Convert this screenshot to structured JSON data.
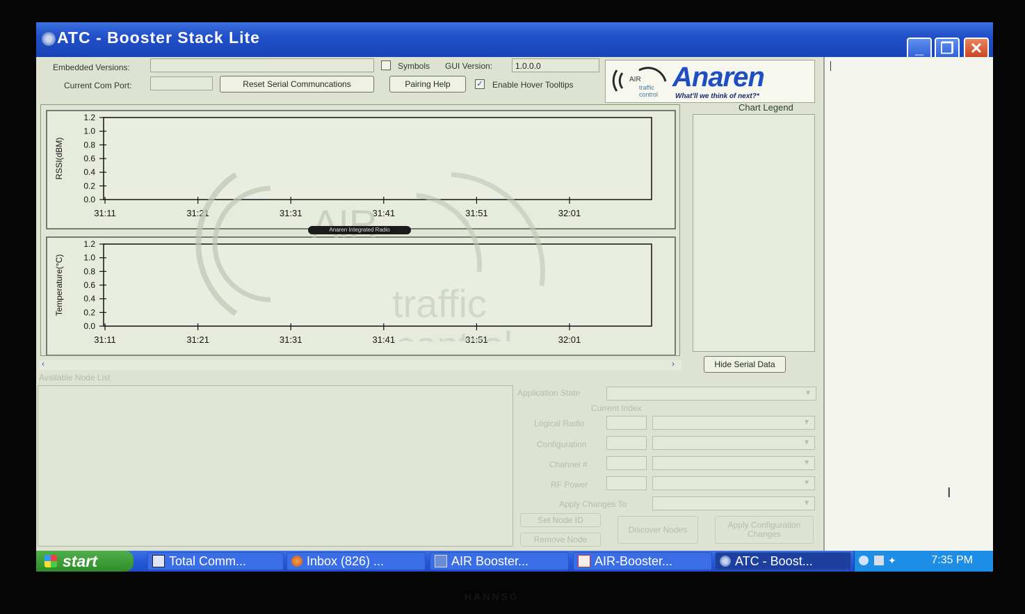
{
  "window": {
    "title": "ATC - Booster Stack Lite",
    "minimize_label": "_",
    "maximize_label": "❐",
    "close_label": "✕"
  },
  "toolbar": {
    "embedded_versions_label": "Embedded Versions:",
    "embedded_versions_value": "",
    "current_com_port_label": "Current Com Port:",
    "current_com_port_value": "",
    "reset_serial_label": "Reset Serial Communcations",
    "symbols_label": "Symbols",
    "symbols_checked": false,
    "gui_version_label": "GUI Version:",
    "gui_version_value": "1.0.0.0",
    "pairing_help_label": "Pairing Help",
    "hover_tooltips_label": "Enable Hover Tooltips",
    "hover_tooltips_checked": true
  },
  "logo": {
    "brand": "Anaren",
    "tagline": "What'll we think of next?*",
    "mark_top": "AIR",
    "mark_mid": "traffic",
    "mark_bottom": "control"
  },
  "watermark": {
    "word1": "AIR",
    "word2": "traffic",
    "word3": "control",
    "caption": "Anaren Integrated Radio"
  },
  "legend": {
    "title": "Chart Legend",
    "hide_serial_label": "Hide Serial Data"
  },
  "chart_data": [
    {
      "type": "line",
      "ylabel": "RSSI(dBM)",
      "yticks": [
        "1.2",
        "1.0",
        "0.8",
        "0.6",
        "0.4",
        "0.2",
        "0.0"
      ],
      "ylim": [
        0,
        1.2
      ],
      "xticks": [
        "31:11",
        "31:21",
        "31:31",
        "31:41",
        "31:51",
        "32:01"
      ],
      "series": []
    },
    {
      "type": "line",
      "ylabel": "Temperature(°C)",
      "yticks": [
        "1.2",
        "1.0",
        "0.8",
        "0.6",
        "0.4",
        "0.2",
        "0.0"
      ],
      "ylim": [
        0,
        1.2
      ],
      "xticks": [
        "31:11",
        "31:21",
        "31:31",
        "31:41",
        "31:51",
        "32:01"
      ],
      "series": []
    }
  ],
  "node_panel": {
    "available_node_list_label": "Available Node List",
    "application_state_label": "Application State",
    "current_index_label": "Current Index",
    "logical_radio_label": "Logical Radio",
    "configuration_label": "Configuration",
    "channel_label": "Channel #",
    "rf_power_label": "RF Power",
    "apply_changes_to_label": "Apply Changes To",
    "set_node_id_label": "Set Node ID",
    "remove_node_label": "Remove Node",
    "discover_nodes_label": "Discover Nodes",
    "apply_configuration_label": "Apply Configuration Changes"
  },
  "taskbar": {
    "start_label": "start",
    "tasks": [
      {
        "label": "Total Comm..."
      },
      {
        "label": "Inbox (826) ..."
      },
      {
        "label": "AIR Booster..."
      },
      {
        "label": "AIR-Booster..."
      },
      {
        "label": "ATC - Boost..."
      }
    ],
    "clock": "7:35 PM"
  },
  "bezel": {
    "brand": "HANNSG"
  },
  "colors": {
    "titlebar": "#2150c9",
    "anaren_blue": "#1f4ec2",
    "start_green": "#2f8c2c",
    "tray_blue": "#1d8de6"
  }
}
